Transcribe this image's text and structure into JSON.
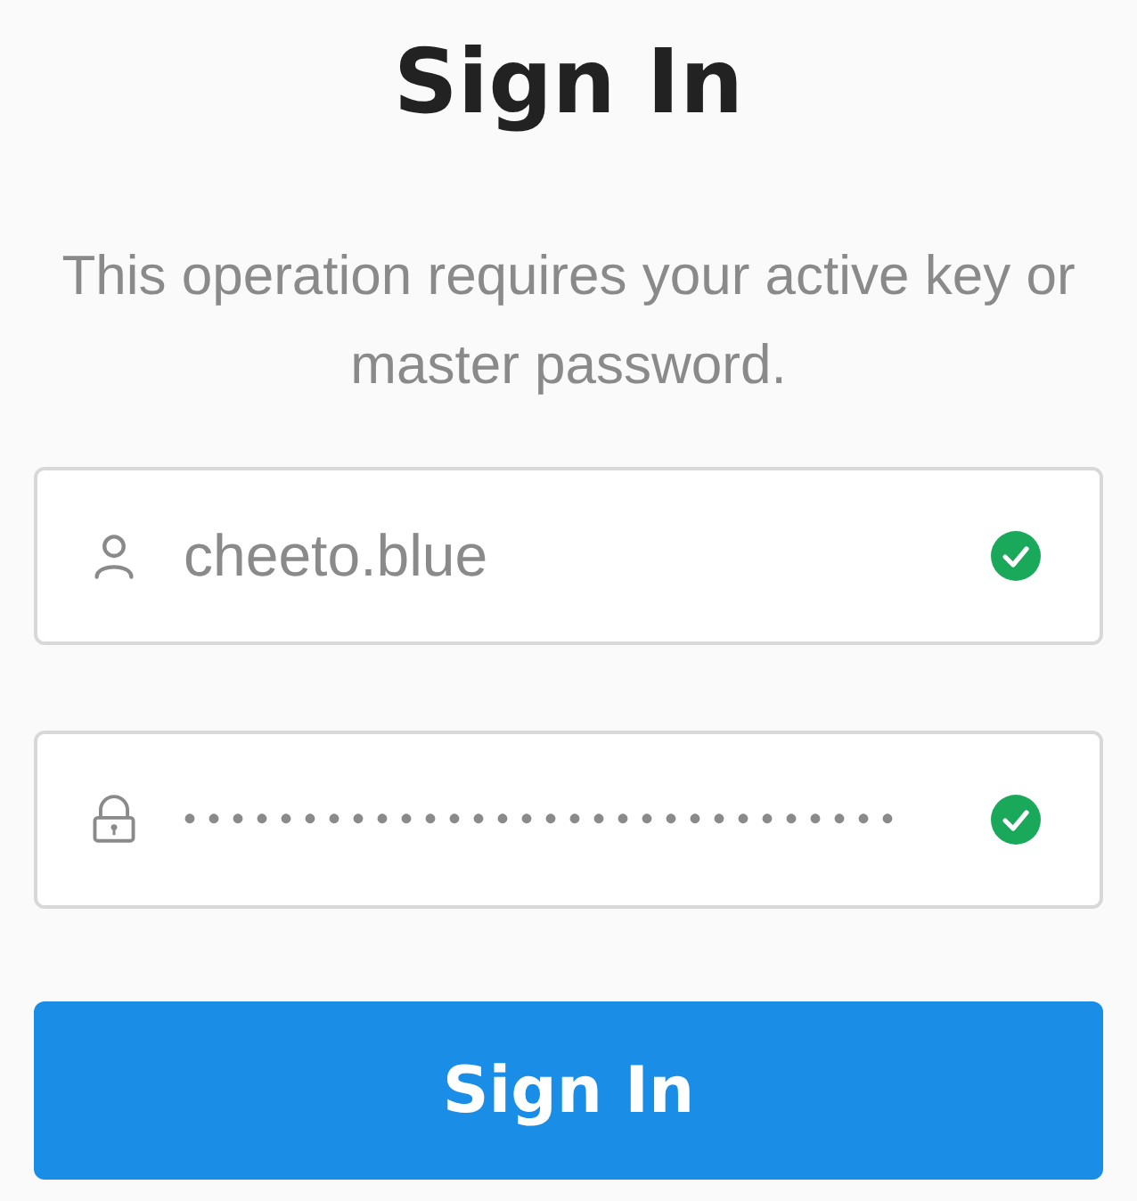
{
  "title": "Sign In",
  "subtitle": "This operation requires your active key or master password.",
  "fields": [
    {
      "kind": "username",
      "value": "cheeto.blue",
      "valid": true
    },
    {
      "kind": "password",
      "value": "••••••••••••••••••••••••••••••",
      "valid": true
    }
  ],
  "button": {
    "label": "Sign In"
  }
}
